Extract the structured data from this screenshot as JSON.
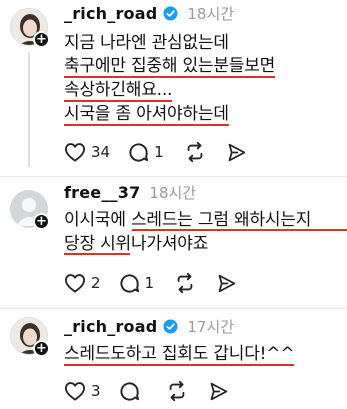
{
  "posts": [
    {
      "username": "_rich_road",
      "time": "18시간",
      "verified": true,
      "avatar": "profile-photo",
      "lines": [
        "지금 나라엔 관심없는데",
        "축구에만 집중해 있는분들보면",
        "속상하긴해요...",
        "시국을 좀 아셔야하는데"
      ],
      "likes": "34",
      "replies": "1"
    },
    {
      "username": "free__37",
      "time": "18시간",
      "verified": false,
      "avatar": "default-avatar",
      "lines": [
        "이시국에 스레드는 그럼 왜하시는지",
        "당장 시위나가셔야죠"
      ],
      "likes": "2",
      "replies": "1"
    },
    {
      "username": "_rich_road",
      "time": "17시간",
      "verified": true,
      "avatar": "profile-photo",
      "lines": [
        "스레드도하고 집회도 갑니다!^^"
      ],
      "likes": "3",
      "replies": ""
    }
  ],
  "icons": [
    "heart-icon",
    "comment-icon",
    "repost-icon",
    "share-icon",
    "verified-badge-icon",
    "follow-plus-icon"
  ],
  "colors": {
    "underline": "#e03128",
    "verified": "#1d9bf0",
    "time": "#9a9a9a"
  }
}
